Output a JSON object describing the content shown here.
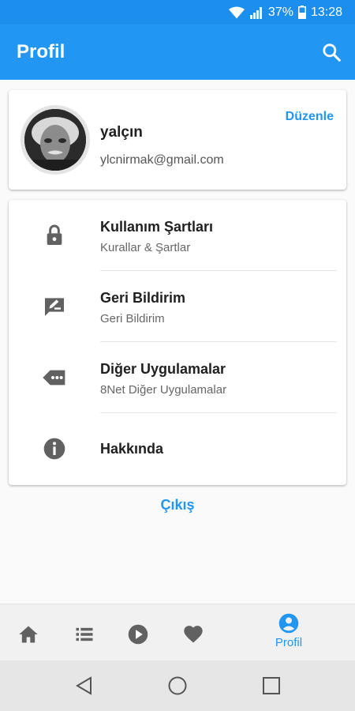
{
  "status_bar": {
    "battery": "37%",
    "time": "13:28"
  },
  "app_bar": {
    "title": "Profil",
    "search_icon": "search-icon"
  },
  "profile": {
    "name": "yalçın",
    "email": "ylcnirmak@gmail.com",
    "edit_label": "Düzenle",
    "avatar_icon": "avatar"
  },
  "menu": {
    "items": [
      {
        "title": "Kullanım Şartları",
        "subtitle": "Kurallar & Şartlar",
        "icon": "lock-icon"
      },
      {
        "title": "Geri Bildirim",
        "subtitle": "Geri Bildirim",
        "icon": "feedback-icon"
      },
      {
        "title": "Diğer Uygulamalar",
        "subtitle": "8Net Diğer Uygulamalar",
        "icon": "more-tag-icon"
      },
      {
        "title": "Hakkında",
        "icon": "info-icon"
      }
    ]
  },
  "logout_label": "Çıkış",
  "bottom_nav": {
    "items": [
      {
        "icon": "home-icon"
      },
      {
        "icon": "list-icon"
      },
      {
        "icon": "play-icon"
      },
      {
        "icon": "heart-icon"
      },
      {
        "icon": "account-icon",
        "label": "Profil",
        "active": true
      }
    ]
  },
  "colors": {
    "primary": "#2196f3",
    "status_bar": "#1c8eee",
    "icon_gray": "#616161"
  }
}
